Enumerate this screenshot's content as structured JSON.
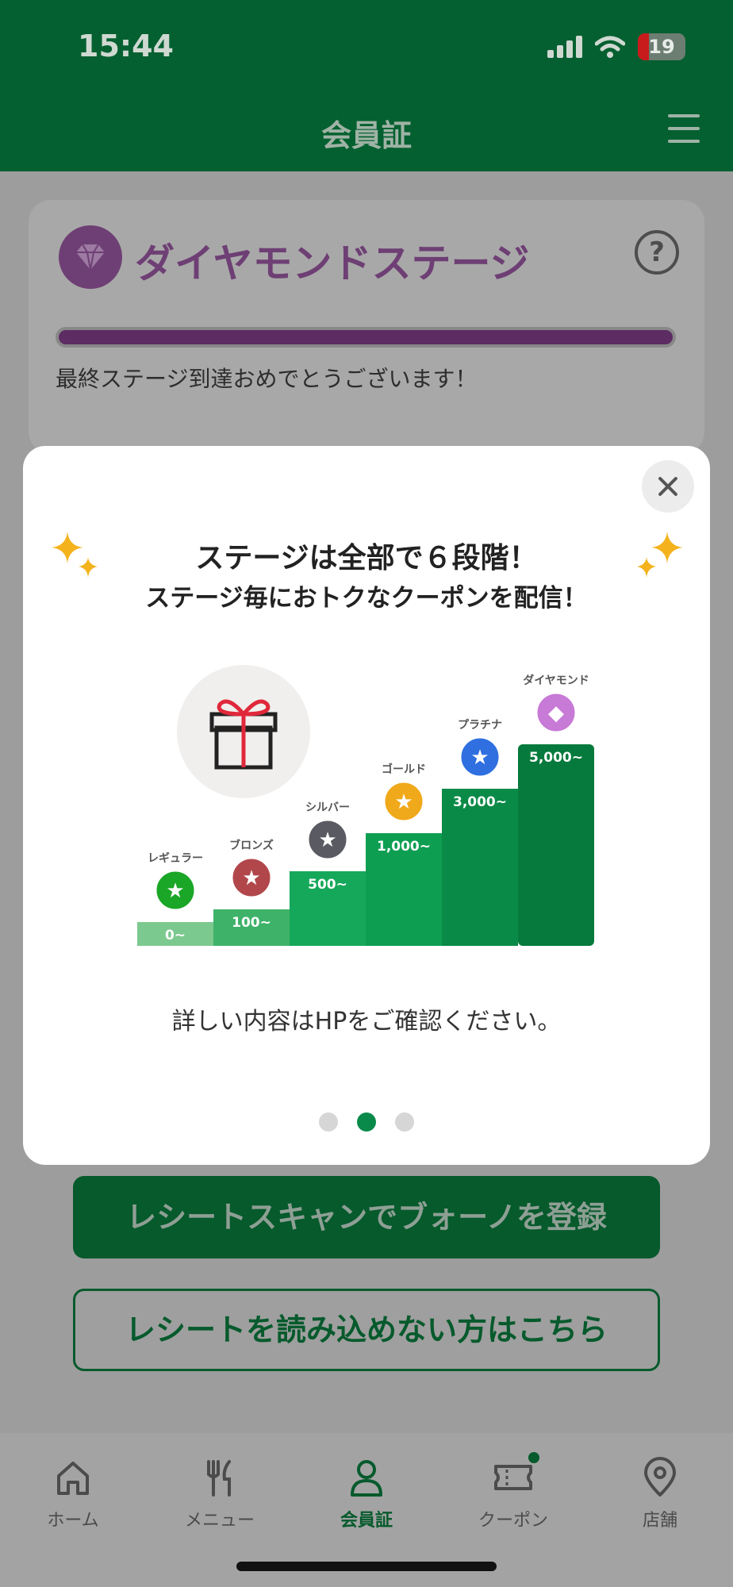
{
  "status_bar": {
    "time": "15:44",
    "battery": "19"
  },
  "header": {
    "title": "会員証"
  },
  "stage_card": {
    "stage_name": "ダイヤモンドステージ",
    "progress": 1.0,
    "message": "最終ステージ到達おめでとうございます！"
  },
  "modal": {
    "title": "ステージは全部で６段階！",
    "subtitle": "ステージ毎におトクなクーポンを配信！",
    "note": "詳しい内容はHPをご確認ください。",
    "pager": {
      "count": 3,
      "active_index": 1
    },
    "stages": [
      {
        "name": "レギュラー",
        "threshold": "0~",
        "badge_color": "#1aa626",
        "step_color": "#7cc98f"
      },
      {
        "name": "ブロンズ",
        "threshold": "100~",
        "badge_color": "#b1474b",
        "step_color": "#3fb26a"
      },
      {
        "name": "シルバー",
        "threshold": "500~",
        "badge_color": "#5a5a62",
        "step_color": "#16a85a"
      },
      {
        "name": "ゴールド",
        "threshold": "1,000~",
        "badge_color": "#f0a91a",
        "step_color": "#0e9e52"
      },
      {
        "name": "プラチナ",
        "threshold": "3,000~",
        "badge_color": "#2f6fe0",
        "step_color": "#0a8a47"
      },
      {
        "name": "ダイヤモンド",
        "threshold": "5,000~",
        "badge_color": "#c77ad6",
        "step_color": "#067a3c"
      }
    ],
    "gift_icon": "gift-icon"
  },
  "buttons": {
    "scan": "レシートスキャンでブォーノを登録",
    "manual": "レシートを読み込めない方はこちら"
  },
  "bottom_nav": [
    {
      "label": "ホーム",
      "icon": "home-icon"
    },
    {
      "label": "メニュー",
      "icon": "fork-knife-icon"
    },
    {
      "label": "会員証",
      "icon": "person-icon",
      "active": true
    },
    {
      "label": "クーポン",
      "icon": "ticket-icon",
      "has_dot": true
    },
    {
      "label": "店舗",
      "icon": "location-pin-icon"
    }
  ],
  "colors": {
    "brand_green": "#046030",
    "accent_green": "#0a8a4a",
    "diamond_purple": "#a64cb8",
    "sparkle": "#f4b21d"
  }
}
